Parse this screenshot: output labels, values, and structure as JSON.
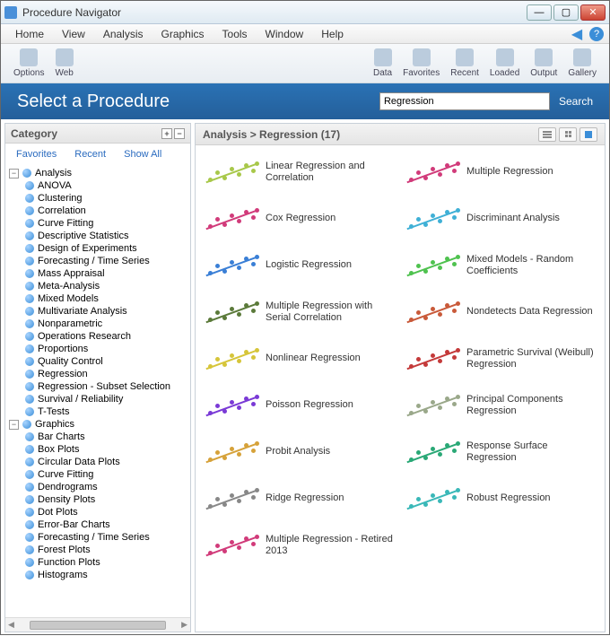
{
  "window": {
    "title": "Procedure Navigator"
  },
  "menubar": [
    "Home",
    "View",
    "Analysis",
    "Graphics",
    "Tools",
    "Window",
    "Help"
  ],
  "toolbar_left": [
    {
      "label": "Options",
      "name": "options-button"
    },
    {
      "label": "Web",
      "name": "web-button"
    }
  ],
  "toolbar_right": [
    {
      "label": "Data",
      "name": "data-button"
    },
    {
      "label": "Favorites",
      "name": "favorites-button"
    },
    {
      "label": "Recent",
      "name": "recent-button"
    },
    {
      "label": "Loaded",
      "name": "loaded-button"
    },
    {
      "label": "Output",
      "name": "output-button"
    },
    {
      "label": "Gallery",
      "name": "gallery-button"
    }
  ],
  "banner": {
    "title": "Select a Procedure",
    "search_value": "Regression",
    "search_label": "Search"
  },
  "sidebar": {
    "header": "Category",
    "links": [
      "Favorites",
      "Recent",
      "Show All"
    ],
    "analysis_label": "Analysis",
    "analysis_items": [
      "ANOVA",
      "Clustering",
      "Correlation",
      "Curve Fitting",
      "Descriptive Statistics",
      "Design of Experiments",
      "Forecasting / Time Series",
      "Mass Appraisal",
      "Meta-Analysis",
      "Mixed Models",
      "Multivariate Analysis",
      "Nonparametric",
      "Operations Research",
      "Proportions",
      "Quality Control",
      "Regression",
      "Regression - Subset Selection",
      "Survival / Reliability",
      "T-Tests"
    ],
    "graphics_label": "Graphics",
    "graphics_items": [
      "Bar Charts",
      "Box Plots",
      "Circular Data Plots",
      "Curve Fitting",
      "Dendrograms",
      "Density Plots",
      "Dot Plots",
      "Error-Bar Charts",
      "Forecasting / Time Series",
      "Forest Plots",
      "Function Plots",
      "Histograms"
    ]
  },
  "main": {
    "breadcrumb": "Analysis > Regression (17)"
  },
  "procedures": [
    {
      "label": "Linear Regression and Correlation",
      "color": "#a8c84a"
    },
    {
      "label": "Multiple Regression",
      "color": "#d13b7a"
    },
    {
      "label": "Cox Regression",
      "color": "#d13b7a"
    },
    {
      "label": "Discriminant Analysis",
      "color": "#3fb0d6"
    },
    {
      "label": "Logistic Regression",
      "color": "#3a7fd6"
    },
    {
      "label": "Mixed Models - Random Coefficients",
      "color": "#4fc24f"
    },
    {
      "label": "Multiple Regression with Serial Correlation",
      "color": "#5b7a3a"
    },
    {
      "label": "Nondetects Data Regression",
      "color": "#c95a3a"
    },
    {
      "label": "Nonlinear Regression",
      "color": "#d6c53a"
    },
    {
      "label": "Parametric Survival (Weibull) Regression",
      "color": "#c43a3a"
    },
    {
      "label": "Poisson Regression",
      "color": "#7a3ad6"
    },
    {
      "label": "Principal Components Regression",
      "color": "#9aa88a"
    },
    {
      "label": "Probit Analysis",
      "color": "#d6a23a"
    },
    {
      "label": "Response Surface Regression",
      "color": "#2aa876"
    },
    {
      "label": "Ridge Regression",
      "color": "#888888"
    },
    {
      "label": "Robust Regression",
      "color": "#3ab8b8"
    },
    {
      "label": "Multiple Regression - Retired 2013",
      "color": "#d13b7a"
    }
  ]
}
